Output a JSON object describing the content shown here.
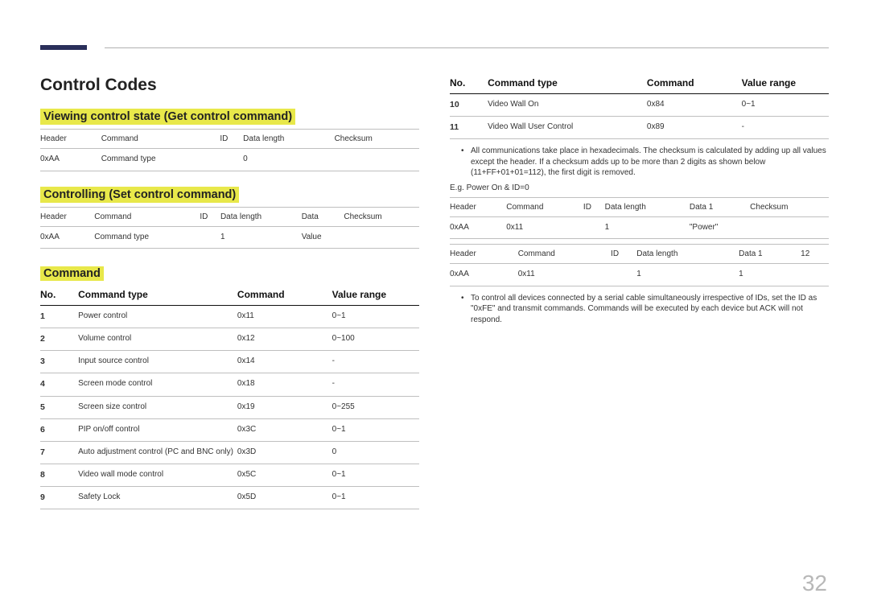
{
  "page_number": "32",
  "left": {
    "title": "Control Codes",
    "sec1": {
      "heading": "Viewing control state (Get control command)",
      "table": {
        "headers": [
          "Header",
          "Command",
          "ID",
          "Data length",
          "Checksum"
        ],
        "row": [
          "0xAA",
          "Command type",
          "",
          "0",
          ""
        ]
      }
    },
    "sec2": {
      "heading": "Controlling (Set control command)",
      "table": {
        "headers": [
          "Header",
          "Command",
          "ID",
          "Data length",
          "Data",
          "Checksum"
        ],
        "row": [
          "0xAA",
          "Command type",
          "",
          "1",
          "Value",
          ""
        ]
      }
    },
    "sec3": {
      "heading": "Command",
      "columns": {
        "no": "No.",
        "ct": "Command type",
        "cmd": "Command",
        "vr": "Value range"
      },
      "rows": [
        {
          "no": "1",
          "ct": "Power control",
          "cmd": "0x11",
          "vr": "0~1"
        },
        {
          "no": "2",
          "ct": "Volume control",
          "cmd": "0x12",
          "vr": "0~100"
        },
        {
          "no": "3",
          "ct": "Input source control",
          "cmd": "0x14",
          "vr": "-"
        },
        {
          "no": "4",
          "ct": "Screen mode control",
          "cmd": "0x18",
          "vr": "-"
        },
        {
          "no": "5",
          "ct": "Screen size control",
          "cmd": "0x19",
          "vr": "0~255"
        },
        {
          "no": "6",
          "ct": "PIP on/off control",
          "cmd": "0x3C",
          "vr": "0~1"
        },
        {
          "no": "7",
          "ct": "Auto adjustment control (PC and BNC only)",
          "cmd": "0x3D",
          "vr": "0"
        },
        {
          "no": "8",
          "ct": "Video wall mode control",
          "cmd": "0x5C",
          "vr": "0~1"
        },
        {
          "no": "9",
          "ct": "Safety Lock",
          "cmd": "0x5D",
          "vr": "0~1"
        }
      ]
    }
  },
  "right": {
    "columns": {
      "no": "No.",
      "ct": "Command type",
      "cmd": "Command",
      "vr": "Value range"
    },
    "rows": [
      {
        "no": "10",
        "ct": "Video Wall On",
        "cmd": "0x84",
        "vr": "0~1"
      },
      {
        "no": "11",
        "ct": "Video Wall User Control",
        "cmd": "0x89",
        "vr": "-"
      }
    ],
    "bullet1": "All communications take place in hexadecimals. The checksum is calculated by adding up all values except the header. If a checksum adds up to be more than 2 digits as shown below (11+FF+01+01=112), the first digit is removed.",
    "eg": "E.g. Power On & ID=0",
    "tableA": {
      "headers": [
        "Header",
        "Command",
        "ID",
        "Data length",
        "Data 1",
        "Checksum"
      ],
      "row": [
        "0xAA",
        "0x11",
        "",
        "1",
        "\"Power\"",
        ""
      ]
    },
    "tableB": {
      "headers": [
        "Header",
        "Command",
        "ID",
        "Data length",
        "Data 1",
        "12"
      ],
      "row": [
        "0xAA",
        "0x11",
        "",
        "1",
        "1",
        ""
      ]
    },
    "bullet2": "To control all devices connected by a serial cable simultaneously irrespective of IDs, set the ID as \"0xFE\" and transmit commands. Commands will be executed by each device but ACK will not respond."
  }
}
